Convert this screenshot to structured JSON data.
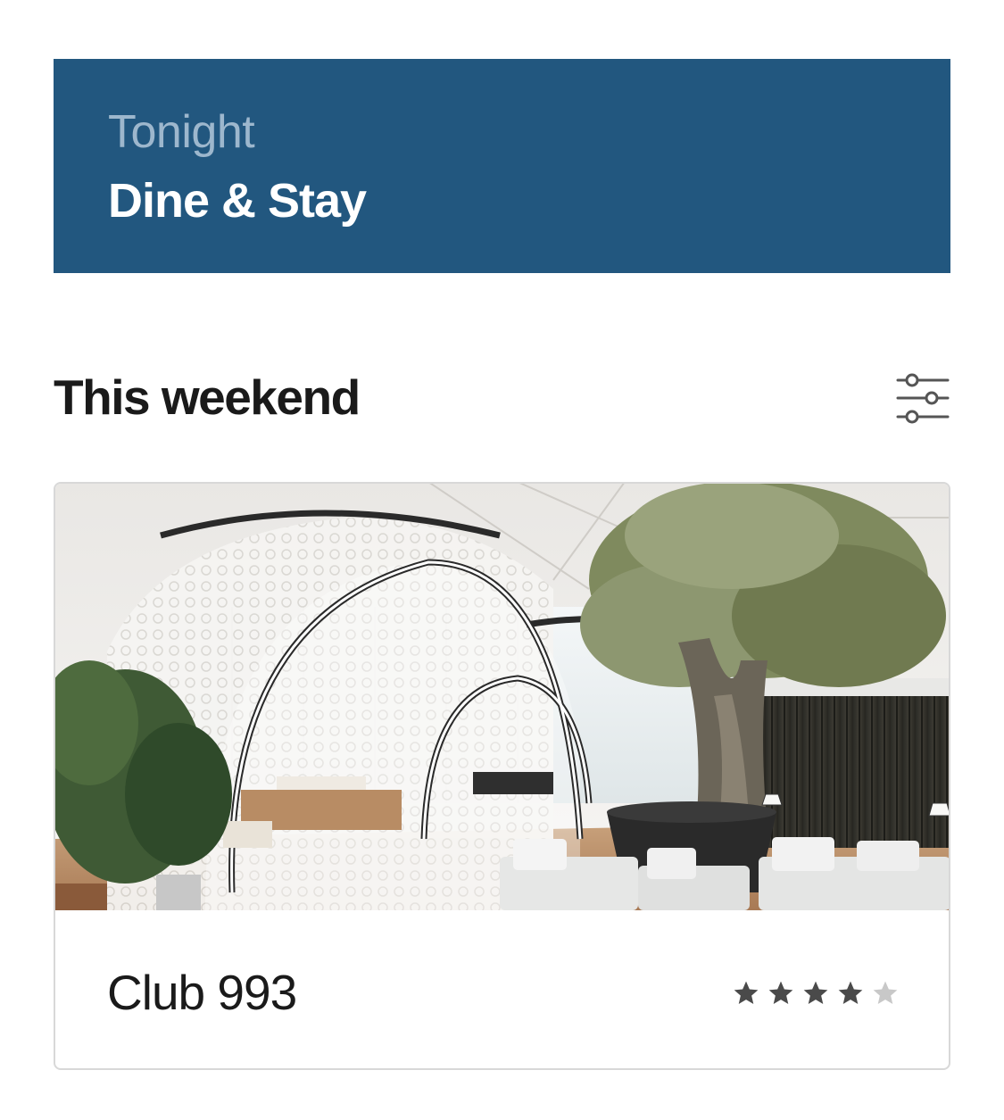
{
  "banner": {
    "kicker": "Tonight",
    "title": "Dine & Stay",
    "background_color": "#22577f"
  },
  "section": {
    "title": "This weekend",
    "filter_icon": "sliders-icon"
  },
  "card": {
    "name": "Club 993",
    "image_description_icon": "lounge-photo",
    "rating": {
      "value": 4,
      "max": 5,
      "filled_color": "#4a4a4a",
      "empty_color": "#c8c8c8"
    }
  }
}
